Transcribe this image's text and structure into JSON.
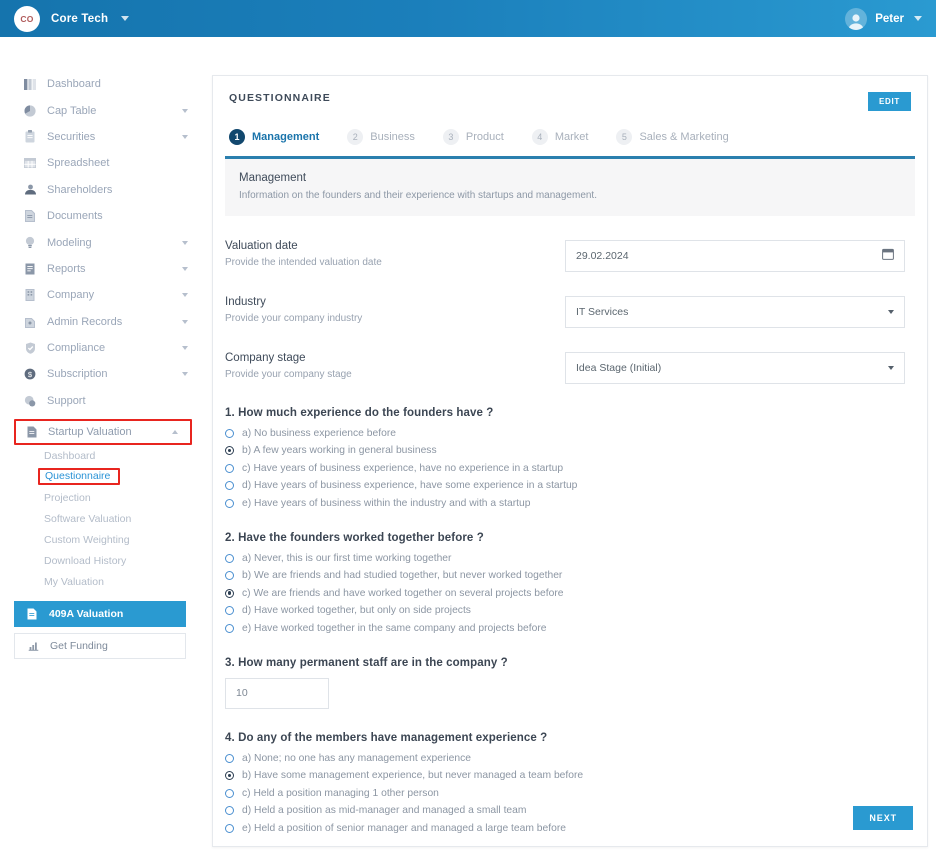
{
  "topbar": {
    "logo_initials": "CO",
    "company_name": "Core Tech",
    "company_caret_icon": "chevron-down-icon",
    "avatar_icon": "user-avatar-icon",
    "user_name": "Peter",
    "user_caret_icon": "chevron-down-icon"
  },
  "sidebar": {
    "items": [
      {
        "label": "Dashboard",
        "icon": "dashboard-icon",
        "expandable": false
      },
      {
        "label": "Cap Table",
        "icon": "pie-chart-icon",
        "expandable": true
      },
      {
        "label": "Securities",
        "icon": "clipboard-icon",
        "expandable": true
      },
      {
        "label": "Spreadsheet",
        "icon": "grid-icon",
        "expandable": false
      },
      {
        "label": "Shareholders",
        "icon": "people-icon",
        "expandable": false
      },
      {
        "label": "Documents",
        "icon": "document-icon",
        "expandable": false
      },
      {
        "label": "Modeling",
        "icon": "lightbulb-icon",
        "expandable": true
      },
      {
        "label": "Reports",
        "icon": "report-icon",
        "expandable": true
      },
      {
        "label": "Company",
        "icon": "building-icon",
        "expandable": true
      },
      {
        "label": "Admin Records",
        "icon": "lock-icon",
        "expandable": true
      },
      {
        "label": "Compliance",
        "icon": "shield-check-icon",
        "expandable": true
      },
      {
        "label": "Subscription",
        "icon": "coin-icon",
        "expandable": true
      },
      {
        "label": "Support",
        "icon": "support-icon",
        "expandable": false
      }
    ],
    "startup_valuation": {
      "label": "Startup Valuation",
      "icon": "document-icon",
      "collapse_icon": "chevron-up-icon",
      "highlighted": true,
      "sub_items": [
        {
          "label": "Dashboard",
          "active": false
        },
        {
          "label": "Questionnaire",
          "active": true
        },
        {
          "label": "Projection",
          "active": false
        },
        {
          "label": "Software Valuation",
          "active": false
        },
        {
          "label": "Custom Weighting",
          "active": false
        },
        {
          "label": "Download History",
          "active": false
        },
        {
          "label": "My Valuation",
          "active": false
        }
      ]
    },
    "primary_button": {
      "label": "409A Valuation",
      "icon": "document-icon"
    },
    "secondary_button": {
      "label": "Get Funding",
      "icon": "chart-up-icon"
    }
  },
  "card": {
    "title": "QUESTIONNAIRE",
    "edit_label": "EDIT",
    "steps": [
      {
        "num": "1",
        "label": "Management",
        "active": true
      },
      {
        "num": "2",
        "label": "Business",
        "active": false
      },
      {
        "num": "3",
        "label": "Product",
        "active": false
      },
      {
        "num": "4",
        "label": "Market",
        "active": false
      },
      {
        "num": "5",
        "label": "Sales & Marketing",
        "active": false
      }
    ],
    "section": {
      "heading": "Management",
      "description": "Information on the founders and their experience with startups and management."
    },
    "fields": [
      {
        "label": "Valuation date",
        "hint": "Provide the intended valuation date",
        "value": "29.02.2024",
        "control": "date",
        "icon": "calendar-icon"
      },
      {
        "label": "Industry",
        "hint": "Provide your company industry",
        "value": "IT Services",
        "control": "select",
        "icon": "chevron-down-icon"
      },
      {
        "label": "Company stage",
        "hint": "Provide your company stage",
        "value": "Idea Stage (Initial)",
        "control": "select",
        "icon": "chevron-down-icon"
      }
    ],
    "questions": [
      {
        "title": "1. How much experience do the founders have ?",
        "type": "radio",
        "options": [
          {
            "text": "a) No business experience before",
            "selected": false
          },
          {
            "text": "b) A few years working in general business",
            "selected": true
          },
          {
            "text": "c) Have years of business experience, have no experience in a startup",
            "selected": false
          },
          {
            "text": "d) Have years of business experience, have some experience in a startup",
            "selected": false
          },
          {
            "text": "e) Have years of business within the industry and with a startup",
            "selected": false
          }
        ]
      },
      {
        "title": "2. Have the founders worked together before ?",
        "type": "radio",
        "options": [
          {
            "text": "a) Never, this is our first time working together",
            "selected": false
          },
          {
            "text": "b) We are friends and had studied together, but never worked together",
            "selected": false
          },
          {
            "text": "c) We are friends and have worked together on several projects before",
            "selected": true
          },
          {
            "text": "d) Have worked together, but only on side projects",
            "selected": false
          },
          {
            "text": "e) Have worked together in the same company and projects before",
            "selected": false
          }
        ]
      },
      {
        "title": "3. How many permanent staff are in the company ?",
        "type": "number",
        "value": "10"
      },
      {
        "title": "4. Do any of the members have management experience ?",
        "type": "radio",
        "options": [
          {
            "text": "a) None; no one has any management experience",
            "selected": false
          },
          {
            "text": "b) Have some management experience, but never managed a team before",
            "selected": true
          },
          {
            "text": "c) Held a position managing 1 other person",
            "selected": false
          },
          {
            "text": "d) Held a position as mid-manager and managed a small team",
            "selected": false
          },
          {
            "text": "e) Held a position of senior manager and managed a large team before",
            "selected": false
          }
        ]
      }
    ],
    "next_label": "NEXT"
  },
  "colors": {
    "brand_blue": "#1b7fbb",
    "accent_cyan": "#2a9ad1",
    "active_step": "#12486e",
    "highlight_red": "#e8251f",
    "link_blue": "#2a93d6"
  }
}
